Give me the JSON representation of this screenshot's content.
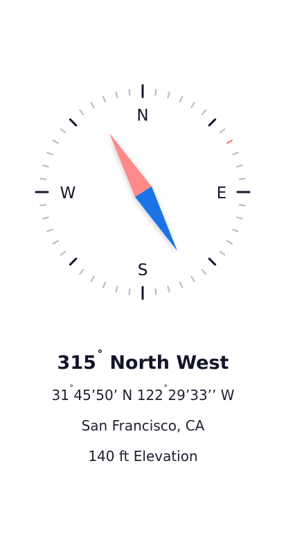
{
  "compass": {
    "labels": {
      "north": "N",
      "east": "E",
      "south": "S",
      "west": "W"
    },
    "colors": {
      "cardinal_tick": "#14142b",
      "minor_tick": "#bdbdbd",
      "heading_tick": "#ff7b7b",
      "needle_north": "#ff8a8a",
      "needle_south": "#1a73e8"
    },
    "needle_icon": "compass-needle-icon"
  },
  "reading": {
    "heading_value": "315",
    "heading_degree_symbol": "˚",
    "heading_direction": "North West",
    "latitude_deg": "31",
    "latitude_rest": "45’50’ N",
    "longitude_deg": "122",
    "longitude_rest": "29’33’’ W",
    "degree_symbol": "˚",
    "location": "San Francisco, CA",
    "elevation": "140 ft Elevation"
  }
}
